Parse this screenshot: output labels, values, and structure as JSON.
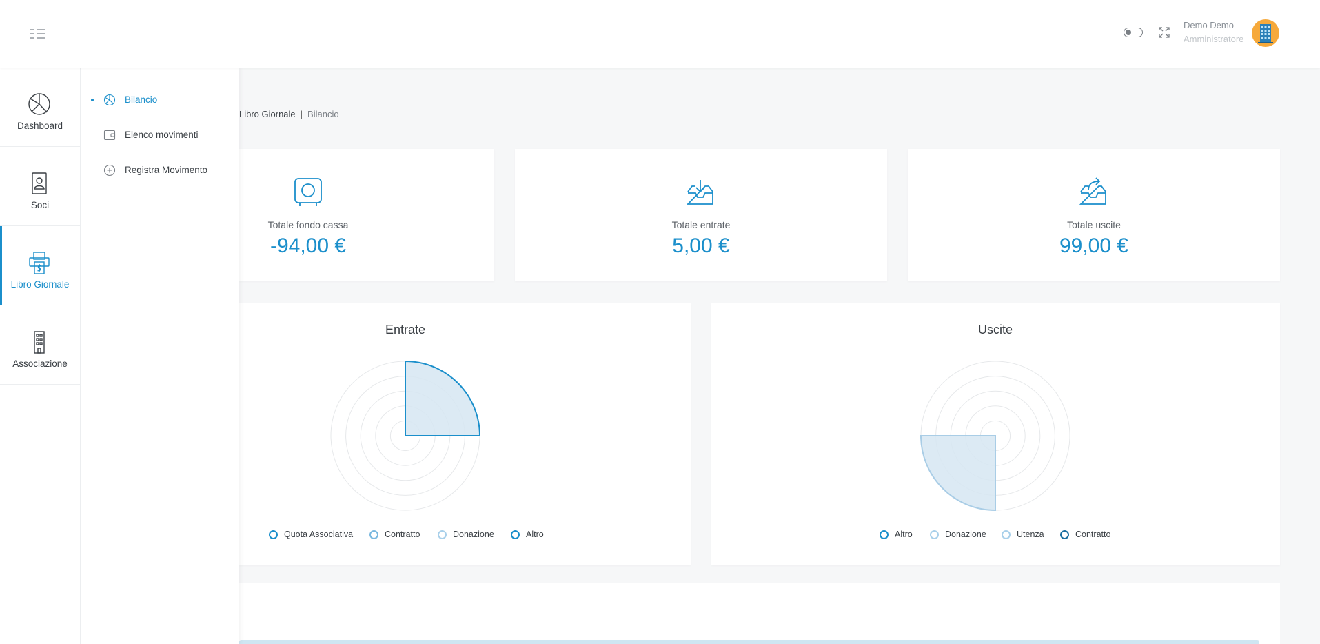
{
  "header": {
    "user_name": "Demo Demo",
    "user_role": "Amministratore"
  },
  "sidebar": {
    "items": [
      {
        "label": "Dashboard",
        "icon": "dashboard-icon"
      },
      {
        "label": "Soci",
        "icon": "member-icon"
      },
      {
        "label": "Libro Giornale",
        "icon": "ledger-icon",
        "active": true
      },
      {
        "label": "Associazione",
        "icon": "building-icon"
      }
    ]
  },
  "submenu": {
    "items": [
      {
        "label": "Bilancio",
        "icon": "balance-icon",
        "active": true
      },
      {
        "label": "Elenco movimenti",
        "icon": "wallet-icon"
      },
      {
        "label": "Registra Movimento",
        "icon": "add-icon"
      }
    ]
  },
  "breadcrumb": {
    "parent": "Libro Giornale",
    "separator": "|",
    "current": "Bilancio"
  },
  "stats": [
    {
      "label": "Totale fondo cassa",
      "value": "-94,00 €",
      "icon": "safe-icon"
    },
    {
      "label": "Totale entrate",
      "value": "5,00 €",
      "icon": "inbox-in-icon"
    },
    {
      "label": "Totale uscite",
      "value": "99,00 €",
      "icon": "inbox-out-icon"
    }
  ],
  "colors": {
    "accent": "#1b8fcb",
    "fill": "#d6e6f2"
  },
  "chart_data": [
    {
      "type": "polarArea",
      "title": "Entrate",
      "categories": [
        "Quota Associativa",
        "Contratto",
        "Donazione",
        "Altro"
      ],
      "values": [
        5,
        0,
        0,
        0
      ],
      "r_max": 5,
      "legend_position": "bottom"
    },
    {
      "type": "polarArea",
      "title": "Uscite",
      "categories": [
        "Altro",
        "Donazione",
        "Utenza",
        "Contratto"
      ],
      "values": [
        0,
        0,
        99,
        0
      ],
      "r_max": 99,
      "legend_position": "bottom"
    }
  ]
}
